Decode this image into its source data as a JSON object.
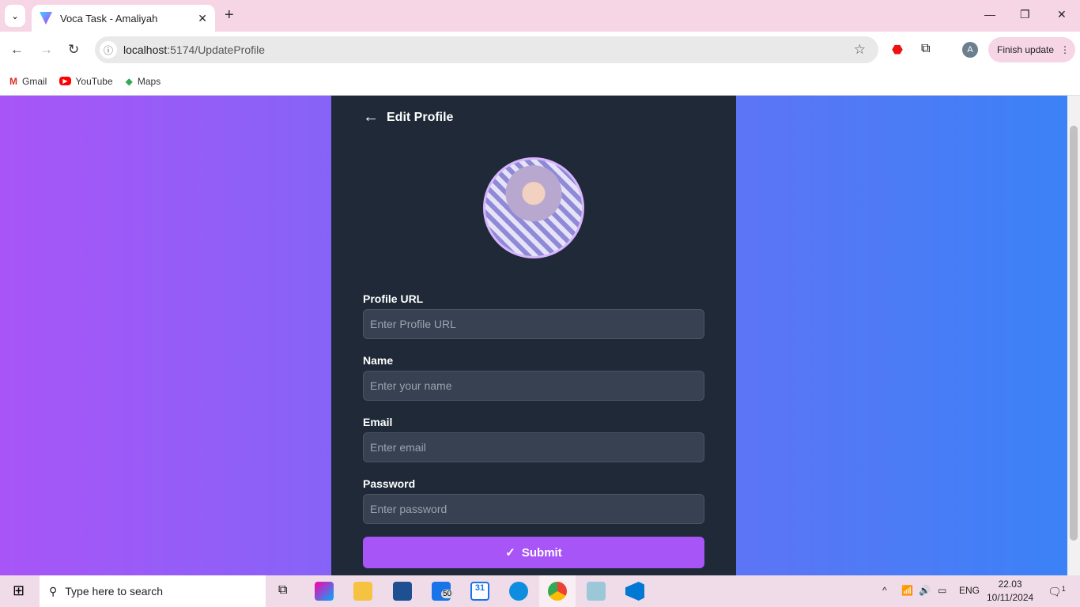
{
  "browser": {
    "tab_title": "Voca Task - Amaliyah",
    "url_host": "localhost",
    "url_path": ":5174/UpdateProfile",
    "finish_update": "Finish update",
    "profile_initial": "A",
    "bookmarks": [
      {
        "label": "Gmail"
      },
      {
        "label": "YouTube"
      },
      {
        "label": "Maps"
      }
    ]
  },
  "page": {
    "title": "Edit Profile",
    "fields": [
      {
        "label": "Profile URL",
        "placeholder": "Enter Profile URL"
      },
      {
        "label": "Name",
        "placeholder": "Enter your name"
      },
      {
        "label": "Email",
        "placeholder": "Enter email"
      },
      {
        "label": "Password",
        "placeholder": "Enter password"
      }
    ],
    "submit": "Submit",
    "accent": "#a855f7"
  },
  "taskbar": {
    "search_placeholder": "Type here to search",
    "mail_badge": "50",
    "calendar_day": "31",
    "lang": "ENG",
    "time": "22.03",
    "date": "10/11/2024",
    "notif_count": "1"
  }
}
